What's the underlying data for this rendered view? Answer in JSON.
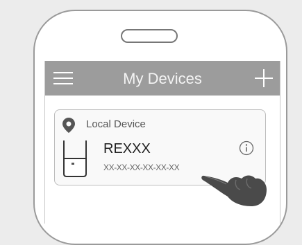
{
  "header": {
    "title": "My Devices",
    "menu_icon": "hamburger-menu-icon",
    "add_icon": "plus-icon"
  },
  "device_card": {
    "section_label": "Local Device",
    "location_icon": "location-pin-icon",
    "device_icon": "range-extender-icon",
    "device_name": "REXXX",
    "mac_address": "XX-XX-XX-XX-XX-XX",
    "info_icon": "info-icon"
  },
  "pointer": {
    "icon": "tapping-hand-icon"
  },
  "colors": {
    "header_bg": "#9c9c9c",
    "page_bg": "#ececec",
    "card_border": "#bdbdbd"
  }
}
